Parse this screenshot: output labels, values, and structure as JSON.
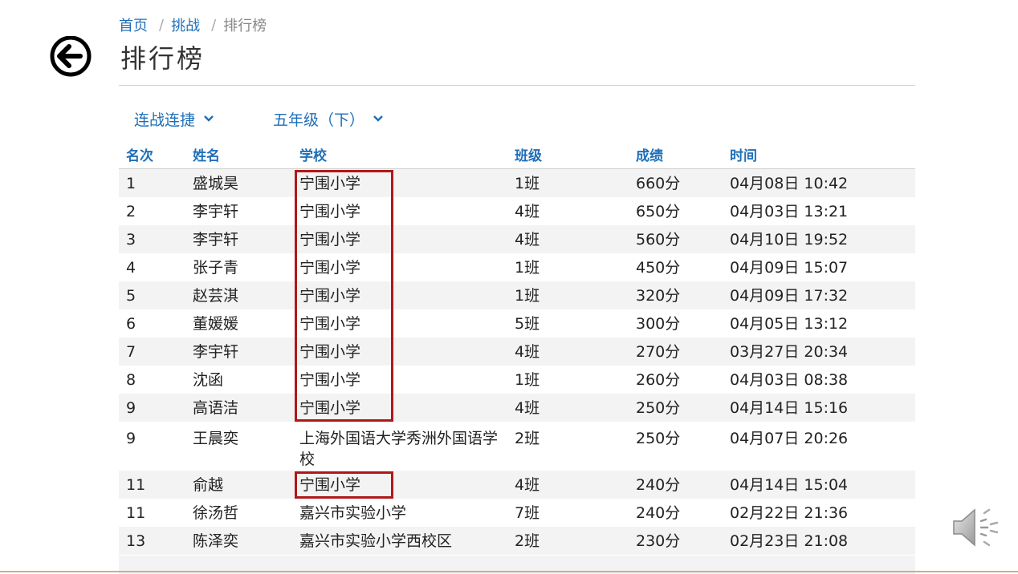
{
  "breadcrumb": {
    "home": "首页",
    "challenge": "挑战",
    "current": "排行榜",
    "separator": "/"
  },
  "title": "排行榜",
  "filters": {
    "mode": "连战连捷",
    "grade": "五年级（下）"
  },
  "table": {
    "headers": {
      "rank": "名次",
      "name": "姓名",
      "school": "学校",
      "class": "班级",
      "score": "成绩",
      "time": "时间"
    },
    "rows": [
      {
        "rank": "1",
        "name": "盛城昊",
        "school": "宁围小学",
        "class": "1班",
        "score": "660分",
        "time": "04月08日 10:42",
        "highlighted": true
      },
      {
        "rank": "2",
        "name": "李宇轩",
        "school": "宁围小学",
        "class": "4班",
        "score": "650分",
        "time": "04月03日 13:21",
        "highlighted": true
      },
      {
        "rank": "3",
        "name": "李宇轩",
        "school": "宁围小学",
        "class": "4班",
        "score": "560分",
        "time": "04月10日 19:52",
        "highlighted": true
      },
      {
        "rank": "4",
        "name": "张子青",
        "school": "宁围小学",
        "class": "1班",
        "score": "450分",
        "time": "04月09日 15:07",
        "highlighted": true
      },
      {
        "rank": "5",
        "name": "赵芸淇",
        "school": "宁围小学",
        "class": "1班",
        "score": "320分",
        "time": "04月09日 17:32",
        "highlighted": true
      },
      {
        "rank": "6",
        "name": "董媛媛",
        "school": "宁围小学",
        "class": "5班",
        "score": "300分",
        "time": "04月05日 13:12",
        "highlighted": true
      },
      {
        "rank": "7",
        "name": "李宇轩",
        "school": "宁围小学",
        "class": "4班",
        "score": "270分",
        "time": "03月27日 20:34",
        "highlighted": true
      },
      {
        "rank": "8",
        "name": "沈函",
        "school": "宁围小学",
        "class": "1班",
        "score": "260分",
        "time": "04月03日 08:38",
        "highlighted": true
      },
      {
        "rank": "9",
        "name": "高语洁",
        "school": "宁围小学",
        "class": "4班",
        "score": "250分",
        "time": "04月14日 15:16",
        "highlighted": true
      },
      {
        "rank": "9",
        "name": "王晨奕",
        "school": "上海外国语大学秀洲外国语学校",
        "class": "2班",
        "score": "250分",
        "time": "04月07日 20:26",
        "highlighted": false
      },
      {
        "rank": "11",
        "name": "俞越",
        "school": "宁围小学",
        "class": "4班",
        "score": "240分",
        "time": "04月14日 15:04",
        "highlighted": true
      },
      {
        "rank": "11",
        "name": "徐汤哲",
        "school": "嘉兴市实验小学",
        "class": "7班",
        "score": "240分",
        "time": "02月22日 21:36",
        "highlighted": false
      },
      {
        "rank": "13",
        "name": "陈泽奕",
        "school": "嘉兴市实验小学西校区",
        "class": "2班",
        "score": "230分",
        "time": "02月23日 21:08",
        "highlighted": false
      }
    ]
  },
  "colors": {
    "link": "#1f6fb8",
    "highlight_border": "#b01818",
    "row_alt": "#f3f3f3"
  },
  "icons": {
    "back": "arrow-left-circle-icon",
    "chevron": "chevron-down-icon",
    "speaker": "speaker-icon"
  }
}
